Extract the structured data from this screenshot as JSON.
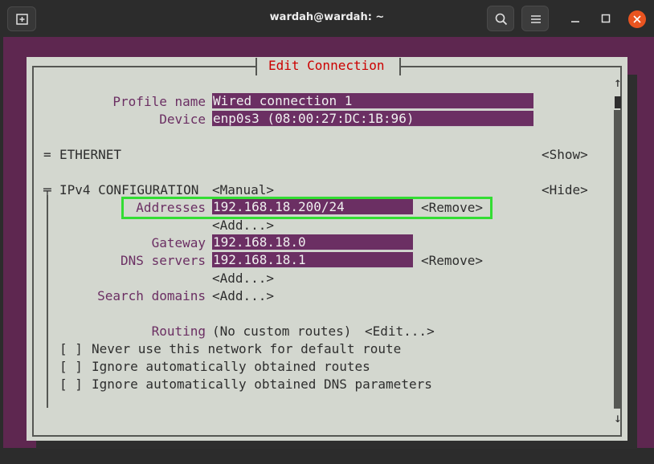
{
  "window": {
    "title": "wardah@wardah: ~"
  },
  "dialog": {
    "title": "Edit Connection",
    "profile_name_label": "Profile name",
    "profile_name_value": "Wired connection 1",
    "device_label": "Device",
    "device_value": "enp0s3 (08:00:27:DC:1B:96)",
    "ethernet_marker": "=",
    "ethernet_label": "ETHERNET",
    "ethernet_toggle": "<Show>",
    "ipv4_marker": "╤",
    "ipv4_label": "IPv4 CONFIGURATION",
    "ipv4_method": "<Manual>",
    "ipv4_toggle": "<Hide>",
    "addresses_label": "Addresses",
    "address_value": "192.168.18.200/24",
    "address_remove": "<Remove>",
    "address_add": "<Add...>",
    "gateway_label": "Gateway",
    "gateway_value": "192.168.18.0",
    "dns_label": "DNS servers",
    "dns_value": "192.168.18.1",
    "dns_remove": "<Remove>",
    "dns_add": "<Add...>",
    "search_label": "Search domains",
    "search_add": "<Add...>",
    "routing_label": "Routing",
    "routing_value": "(No custom routes)",
    "routing_edit": "<Edit...>",
    "checkboxes": [
      {
        "box": "[ ]",
        "label": "Never use this network for default route"
      },
      {
        "box": "[ ]",
        "label": "Ignore automatically obtained routes"
      },
      {
        "box": "[ ]",
        "label": "Ignore automatically obtained DNS parameters"
      }
    ],
    "scroll_up": "↑",
    "scroll_down": "↓"
  },
  "colors": {
    "terminal_bg": "#5e2750",
    "dialog_bg": "#d3d7cf",
    "label": "#6b2f63",
    "field_bg": "#6b2f63",
    "title": "#cc0000",
    "highlight": "#33dd33",
    "close_button": "#e95420"
  },
  "icons": {
    "new_tab": "new-tab-icon",
    "search": "search-icon",
    "menu": "hamburger-menu-icon",
    "minimize": "minimize-icon",
    "maximize": "maximize-icon",
    "close": "close-icon"
  }
}
